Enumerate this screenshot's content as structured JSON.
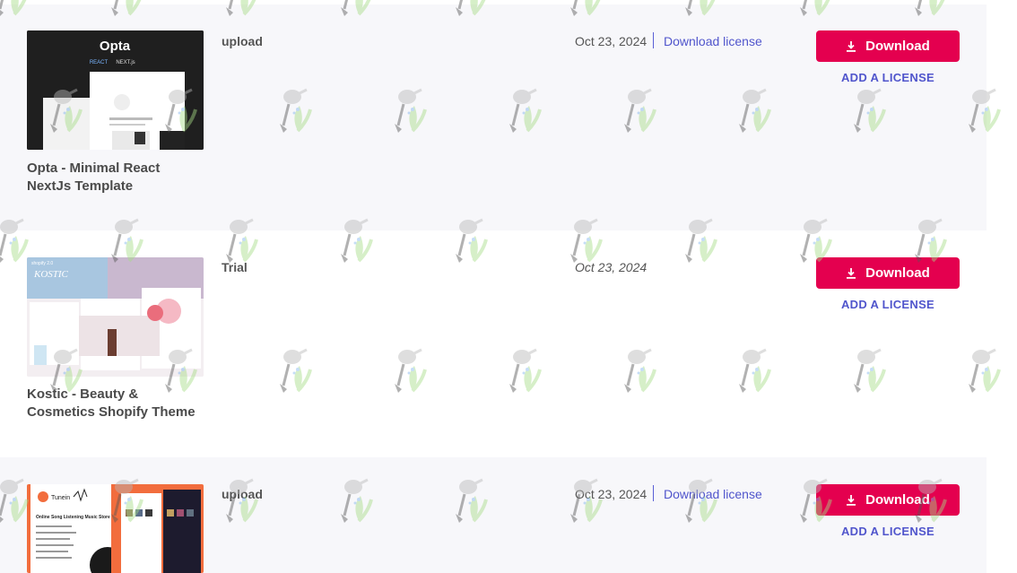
{
  "items": [
    {
      "title": "Opta - Minimal React NextJs Template",
      "thumb_heading": "Opta",
      "thumb_tags": [
        "REACT",
        "NEXT.js"
      ],
      "kind": "upload",
      "date": "Oct 23, 2024",
      "license_link": "Download license",
      "download_label": "Download",
      "add_license_label": "ADD A LICENSE"
    },
    {
      "title": "Kostic - Beauty & Cosmetics Shopify Theme",
      "thumb_heading": "KOSTIC",
      "thumb_tags": [
        "shopify 2.0"
      ],
      "kind": "Trial",
      "date": "Oct 23, 2024",
      "download_label": "Download",
      "add_license_label": "ADD A LICENSE"
    },
    {
      "title": "",
      "thumb_heading": "Tunein",
      "thumb_subheading": "Online Song Listening Music Store",
      "kind": "upload",
      "date": "Oct 23, 2024",
      "license_link": "Download license",
      "download_label": "Download",
      "add_license_label": "ADD A LICENSE"
    }
  ],
  "colors": {
    "accent": "#e4004f",
    "link": "#5055cc",
    "row_alt_bg": "#f7f7fa"
  },
  "icons": {
    "download": "download-icon",
    "watermark": "watering-can-plant-watermark"
  }
}
